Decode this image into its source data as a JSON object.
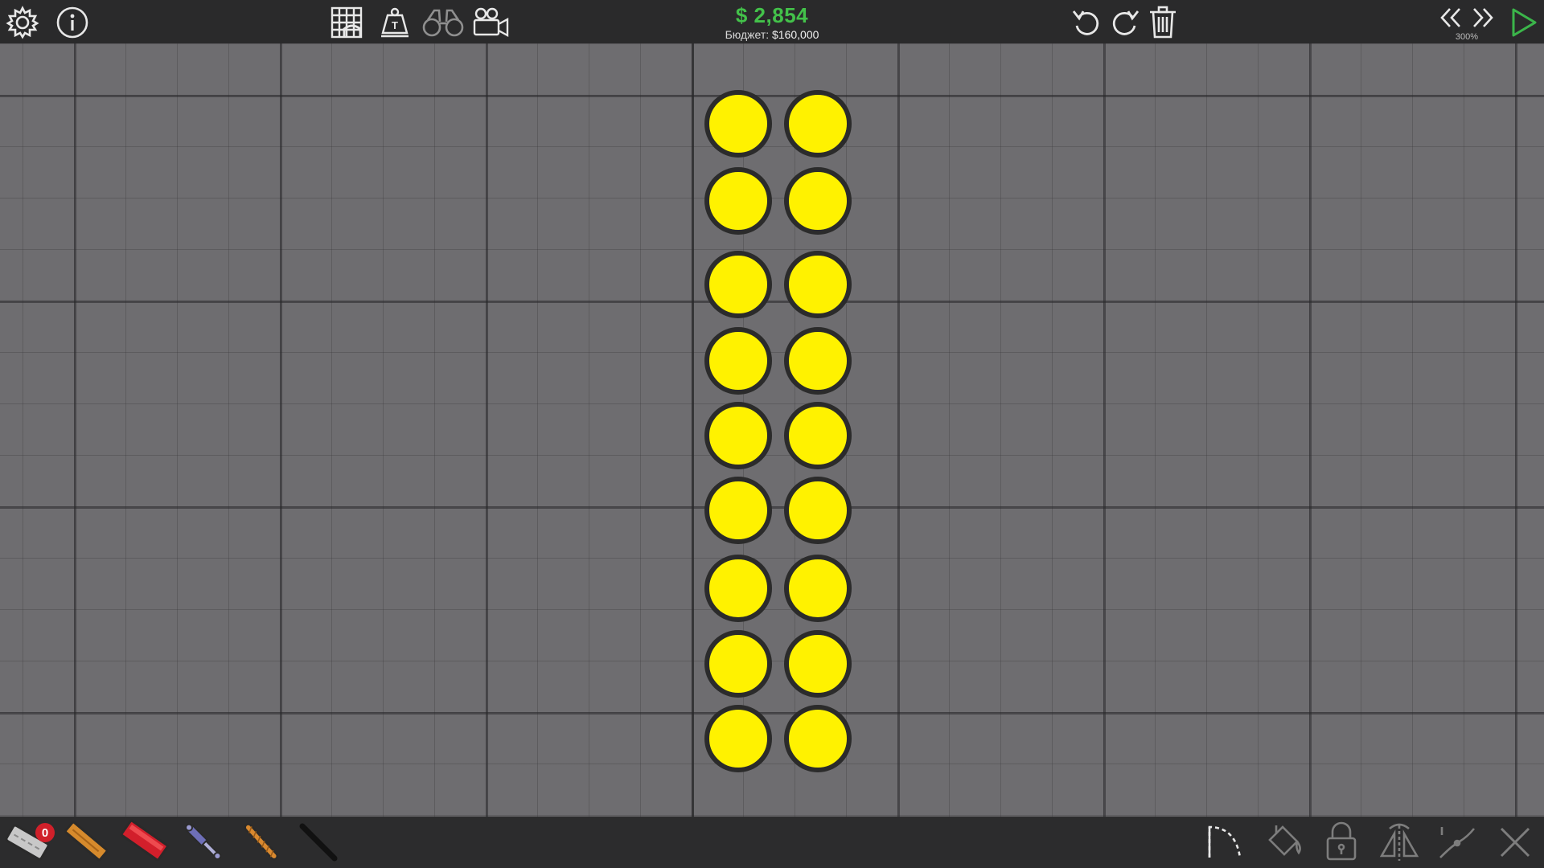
{
  "hud": {
    "money": "$ 2,854",
    "budget_label": "Бюджет: ",
    "budget_value": "$160,000",
    "zoom": "300%"
  },
  "toolbar": {
    "left_icons": [
      "gear-icon",
      "info-icon"
    ],
    "center_icons": [
      "bridge-grid-icon",
      "weight-icon",
      "binoculars-icon",
      "camera-icon"
    ],
    "right_icons": [
      "undo-icon",
      "redo-icon",
      "trash-icon"
    ],
    "playback_icons": [
      "rewind-icon",
      "fast-forward-icon",
      "play-icon"
    ]
  },
  "materials": {
    "road_badge": "0",
    "items": [
      "road",
      "wood",
      "steel",
      "hydraulic",
      "rope",
      "cable"
    ]
  },
  "edit_tools": [
    "curve-icon",
    "paint-bucket-icon",
    "lock-icon",
    "flip-icon",
    "split-icon",
    "close-icon"
  ],
  "colors": {
    "topbar": "#2a2a2b",
    "money": "#43c24a",
    "wheel_fill": "#fff200",
    "wheel_outline": "#2b2b2b",
    "play": "#3bb54a",
    "badge": "#d0202a"
  },
  "scene": {
    "wheel_columns": 2,
    "wheel_rows": 9
  }
}
